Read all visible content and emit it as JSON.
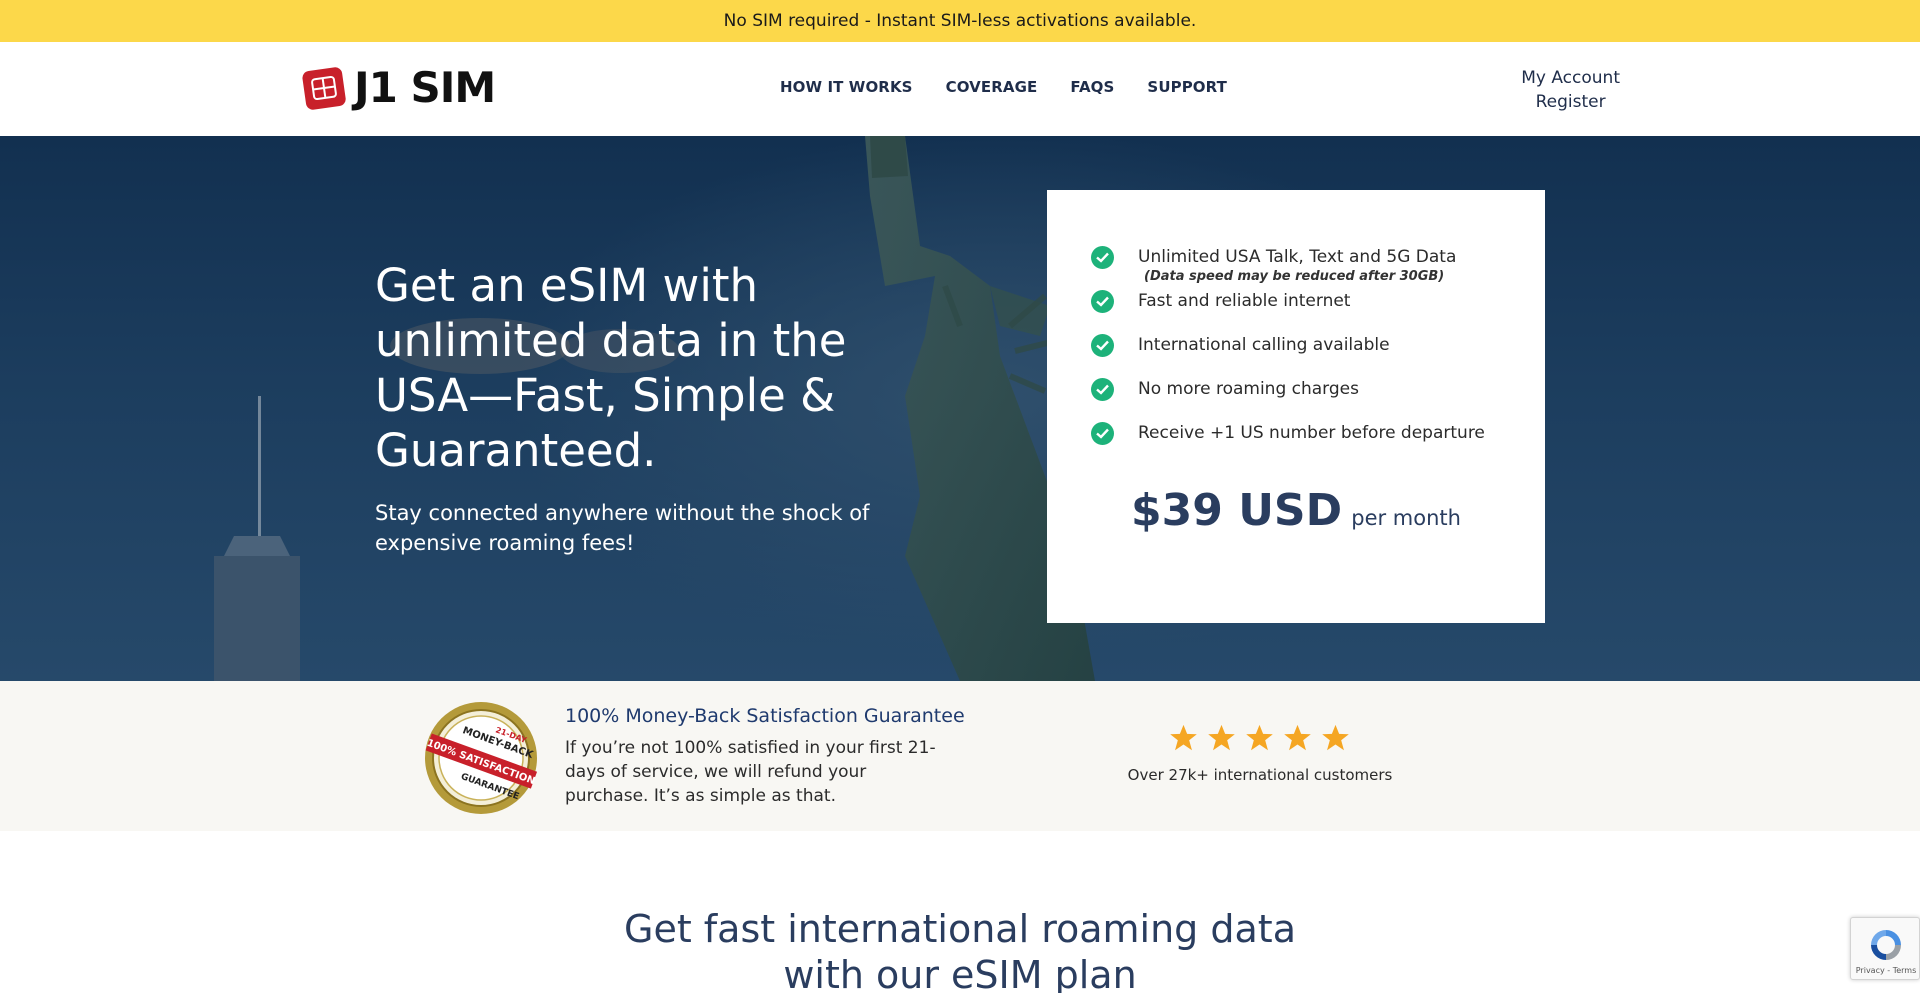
{
  "announcement": "No SIM required - Instant SIM-less activations available.",
  "header": {
    "logo_text": "J1 SIM",
    "nav": [
      "HOW IT WORKS",
      "COVERAGE",
      "FAQS",
      "SUPPORT"
    ],
    "account": [
      "My Account",
      "Register"
    ]
  },
  "hero": {
    "title": "Get an eSIM with unlimited data in the USA—Fast, Simple & Guaranteed.",
    "subtitle": "Stay connected anywhere without the shock of expensive roaming fees!"
  },
  "card": {
    "features": [
      "Unlimited USA Talk, Text and 5G Data",
      "Fast and reliable internet",
      "International calling available",
      "No more roaming charges",
      "Receive +1 US number before departure"
    ],
    "feature_note": "(Data speed may be reduced after 30GB)",
    "price": "$39 USD",
    "price_unit": "per month",
    "check_color": "#1db27a"
  },
  "guarantee": {
    "seal_text": [
      "21-DAY",
      "MONEY-BACK",
      "100% SATISFACTION",
      "GUARANTEE"
    ],
    "title": "100% Money-Back Satisfaction Guarantee",
    "text": "If you’re not 100% satisfied in your first 21-days of service, we will refund your purchase. It’s as simple as that."
  },
  "rating": {
    "stars": 5,
    "star_color": "#f5a623",
    "caption": "Over 27k+ international customers"
  },
  "section_title": [
    "Get fast international roaming data",
    "with our eSIM plan"
  ],
  "recaptcha": "Privacy - Terms",
  "colors": {
    "announcement_bg": "#fcd84a",
    "navy": "#1f2d4a",
    "strip_bg": "#f8f7f3"
  }
}
